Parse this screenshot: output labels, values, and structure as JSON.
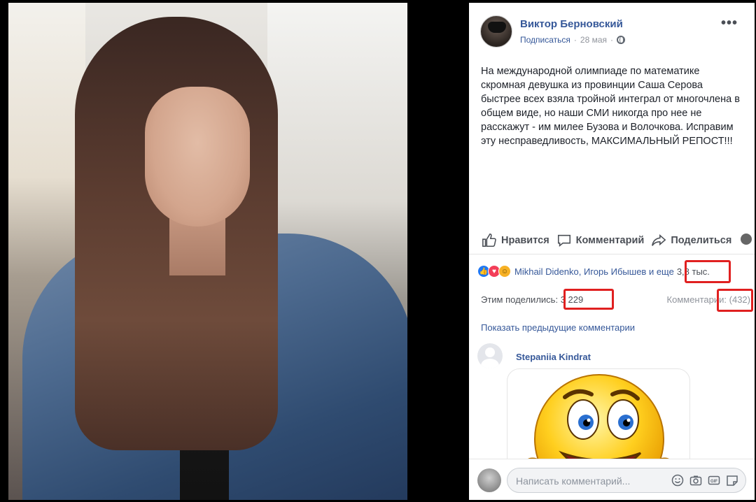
{
  "post": {
    "author": "Виктор Берновский",
    "subscribe": "Подписаться",
    "separator": "·",
    "date": "28 мая",
    "text": "На международной олимпиаде по математике скромная девушка из провинции Саша Серова быстрее всех взяла тройной интеграл от многочлена в общем виде, но наши СМИ никогда про нее не расскажут - им милее Бузова и Волочкова. Исправим эту несправедливость, МАКСИМАЛЬНЫЙ РЕПОСТ!!!"
  },
  "actions": {
    "like": "Нравится",
    "comment": "Комментарий",
    "share": "Поделиться"
  },
  "reactions": {
    "names": "Mikhail Didenko, Игорь Ибышев и еще",
    "count": "3,8 тыс."
  },
  "stats": {
    "shares_label": "Этим поделились:",
    "shares_count": "3 229",
    "comments_label": "Комментарии:",
    "comments_count": "(432)"
  },
  "prev_comments": "Показать предыдущие комментарии",
  "comment": {
    "author": "Stepaniia Kindrat"
  },
  "composer": {
    "placeholder": "Написать комментарий..."
  },
  "colors": {
    "link": "#365899",
    "highlight": "#e02020"
  },
  "icons": [
    "like-icon",
    "comment-icon",
    "share-icon",
    "globe-icon",
    "more-icon",
    "emoji-icon",
    "camera-icon",
    "gif-icon",
    "sticker-icon"
  ]
}
